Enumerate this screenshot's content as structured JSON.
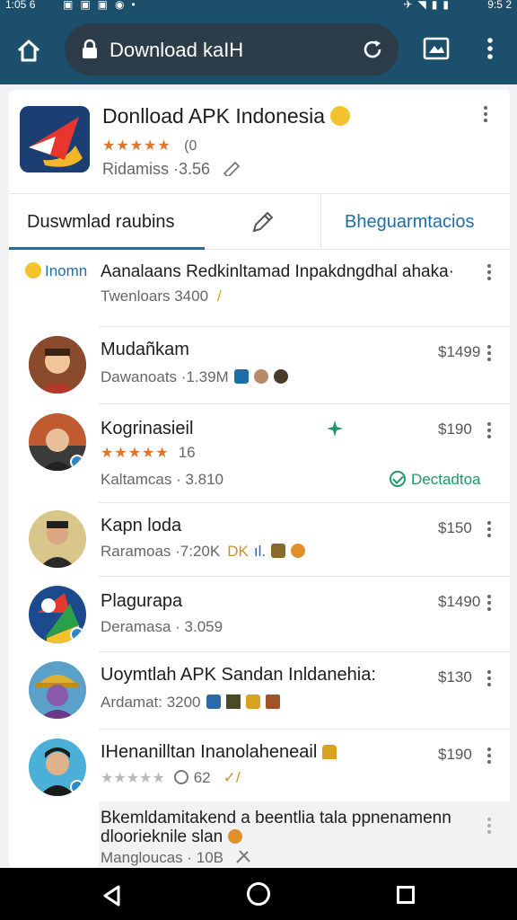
{
  "status_bar": {
    "time": "1:05 6",
    "battery": "9:5 2"
  },
  "browser": {
    "url": "Download kaIH"
  },
  "app": {
    "title": "Donlload APK Indonesia",
    "rating_count": "(0",
    "meta": "Ridamiss ·3.56"
  },
  "tabs": {
    "main_label": "Duswmlad raubins",
    "third_label": "Bheguarmtacios"
  },
  "list": {
    "first": {
      "tag": "Inomn",
      "name": "Aanalaans Redkinltamad Inpakdngdhal ahaka·",
      "sub": "Twenloars  3400"
    },
    "items": [
      {
        "name": "Mudañkam",
        "sub": "Dawanoats ·1.39M",
        "price": "$1499"
      },
      {
        "name": "Kogrinasieil",
        "rating_count": "16",
        "sub": "Kaltamcas · 3.810",
        "price": "$190",
        "status": "Dectadtoa"
      },
      {
        "name": "Kapn loda",
        "sub": "Raramoas ·7:20K",
        "price": "$150"
      },
      {
        "name": "Plagurapa",
        "sub": "Deramasa · 3.059",
        "price": "$1490"
      },
      {
        "name": "Uoymtlah APK Sandan Inldanehia:",
        "sub": "Ardamat:  3200",
        "price": "$130"
      },
      {
        "name": "IHenanilltan Inanolaheneail",
        "rating_count": "62",
        "price": "$190"
      }
    ],
    "last": {
      "text": "Bkemldamitakend a beentlia tala ppnenamenn dloorieknile slan",
      "sub": "Mangloucas · 10B"
    }
  },
  "colors": {
    "accent": "#1e6ea8",
    "star": "#e0752c",
    "topbar": "#1c4f6b",
    "success": "#21966a"
  }
}
